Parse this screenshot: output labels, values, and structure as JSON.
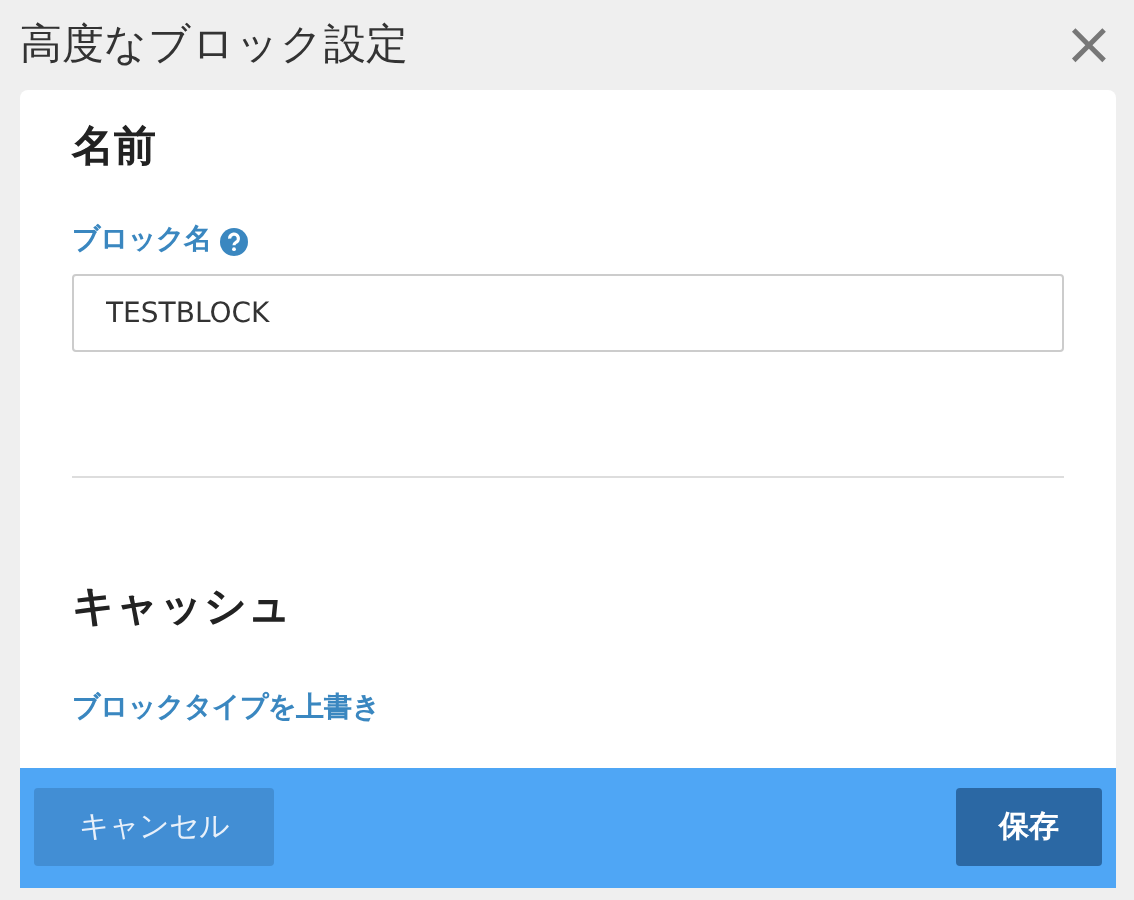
{
  "window": {
    "title": "高度なブロック設定",
    "close": "×"
  },
  "sections": [
    {
      "heading": "名前",
      "field": {
        "label": "ブロック名",
        "value": "TESTBLOCK",
        "help": true
      }
    },
    {
      "heading": "キャッシュ",
      "link": "ブロックタイプを上書き"
    }
  ],
  "buttons": [
    {
      "label": "キャンセル",
      "kind": "secondary"
    },
    {
      "label": "保存",
      "kind": "primary"
    }
  ]
}
